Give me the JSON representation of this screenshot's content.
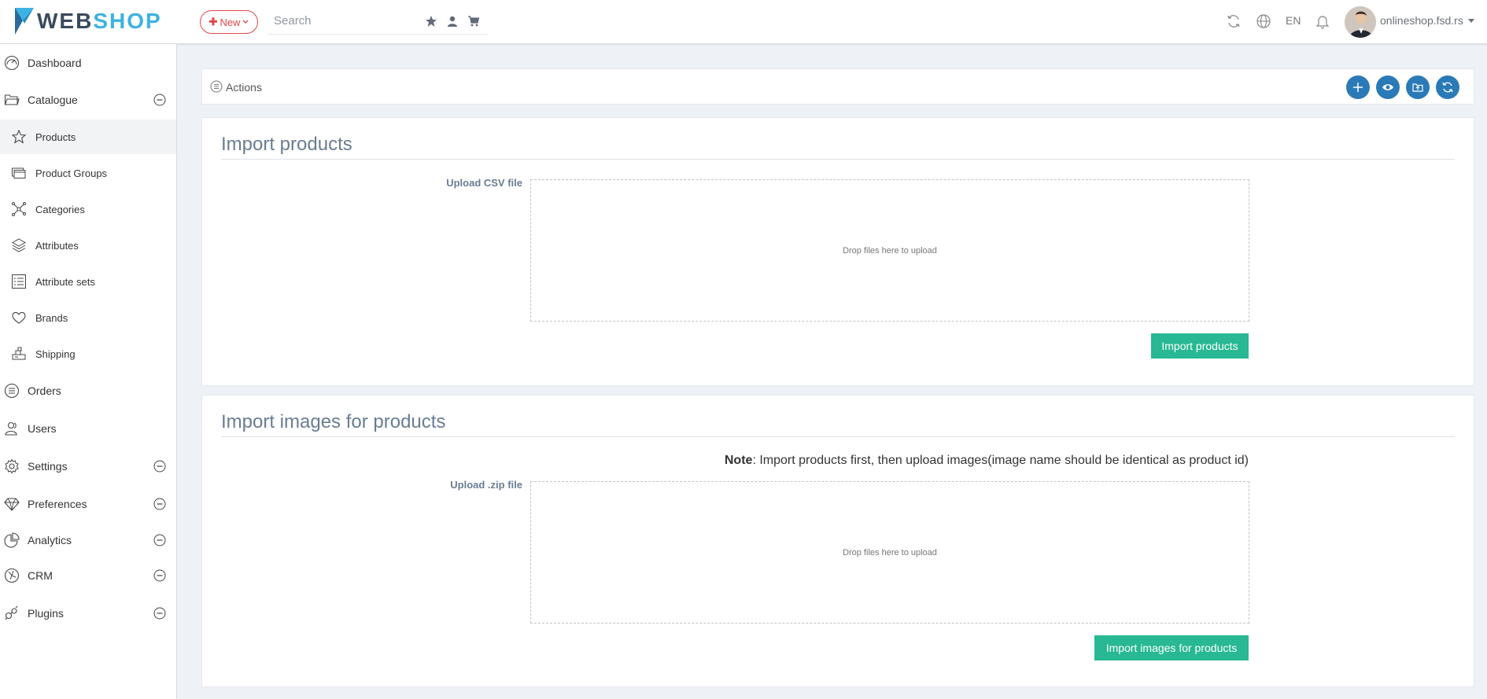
{
  "header": {
    "logo_part1": "WEB",
    "logo_part2": "SHOP",
    "new_label": "New",
    "search_placeholder": "Search",
    "language": "EN",
    "user_name": "onlineshop.fsd.rs"
  },
  "sidebar": {
    "items": [
      {
        "label": "Dashboard",
        "icon": "dashboard-icon"
      },
      {
        "label": "Catalogue",
        "icon": "folder-icon",
        "expanded": true
      },
      {
        "label": "Orders",
        "icon": "orders-icon"
      },
      {
        "label": "Users",
        "icon": "users-icon"
      },
      {
        "label": "Settings",
        "icon": "gear-icon"
      },
      {
        "label": "Preferences",
        "icon": "diamond-icon"
      },
      {
        "label": "Analytics",
        "icon": "pie-chart-icon"
      },
      {
        "label": "CRM",
        "icon": "crm-icon"
      },
      {
        "label": "Plugins",
        "icon": "plugins-icon"
      }
    ],
    "catalogue_items": [
      {
        "label": "Products",
        "icon": "star-icon",
        "active": true
      },
      {
        "label": "Product Groups",
        "icon": "product-groups-icon"
      },
      {
        "label": "Categories",
        "icon": "categories-icon"
      },
      {
        "label": "Attributes",
        "icon": "layers-icon"
      },
      {
        "label": "Attribute sets",
        "icon": "list-icon"
      },
      {
        "label": "Brands",
        "icon": "heart-icon"
      },
      {
        "label": "Shipping",
        "icon": "shipping-icon"
      }
    ]
  },
  "actions": {
    "label": "Actions"
  },
  "import_products": {
    "title": "Import products",
    "upload_label": "Upload CSV file",
    "drop_text": "Drop files here to upload",
    "button_label": "Import products"
  },
  "import_images": {
    "title": "Import images for products",
    "note_bold": "Note",
    "note_text": ": Import products first, then upload images(image name should be identical as product id)",
    "upload_label": "Upload .zip file",
    "drop_text": "Drop files here to upload",
    "button_label": "Import images for products"
  },
  "colors": {
    "accent_blue": "#2b7ab8",
    "brand_green": "#28b893",
    "new_red": "#e0474c",
    "title_slate": "#6a7c94"
  }
}
